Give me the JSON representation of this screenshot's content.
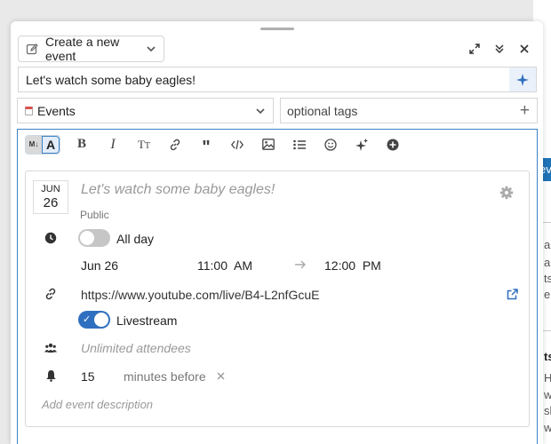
{
  "composer": {
    "action_label": "Create a new event",
    "title_value": "Let's watch some baby eagles!",
    "category_label": "Events",
    "tags_placeholder": "optional tags"
  },
  "event": {
    "month": "JUN",
    "day": "26",
    "title": "Let's watch some baby eagles!",
    "visibility": "Public",
    "all_day_label": "All day",
    "all_day_on": false,
    "start_date": "Jun 26",
    "start_time": "11:00  AM",
    "end_time": "12:00  PM",
    "url": "https://www.youtube.com/live/B4-L2nfGcuE",
    "livestream_label": "Livestream",
    "livestream_on": true,
    "attendees_placeholder": "Unlimited attendees",
    "reminder_value": "15",
    "reminder_unit": "minutes before",
    "description_placeholder": "Add event description"
  },
  "background": {
    "button_fragment": "ev",
    "text_fragments": [
      "ar",
      "a",
      "ts",
      "e",
      "ts",
      "H",
      "w",
      "sl",
      "w"
    ]
  },
  "colors": {
    "accent": "#2f6fbf",
    "editor_border": "#3b82c4",
    "category_swatch": "#d9534f"
  },
  "icons": [
    "pencil-icon",
    "chevron-down-icon",
    "expand-icon",
    "collapse-icon",
    "close-icon",
    "sparkle-icon",
    "plus-icon",
    "bold-icon",
    "italic-icon",
    "heading-icon",
    "link-icon",
    "quote-icon",
    "code-icon",
    "image-icon",
    "bullet-list-icon",
    "emoji-icon",
    "plus-circle-icon",
    "gear-icon",
    "clock-icon",
    "arrow-right-icon",
    "external-link-icon",
    "users-icon",
    "bell-icon"
  ]
}
